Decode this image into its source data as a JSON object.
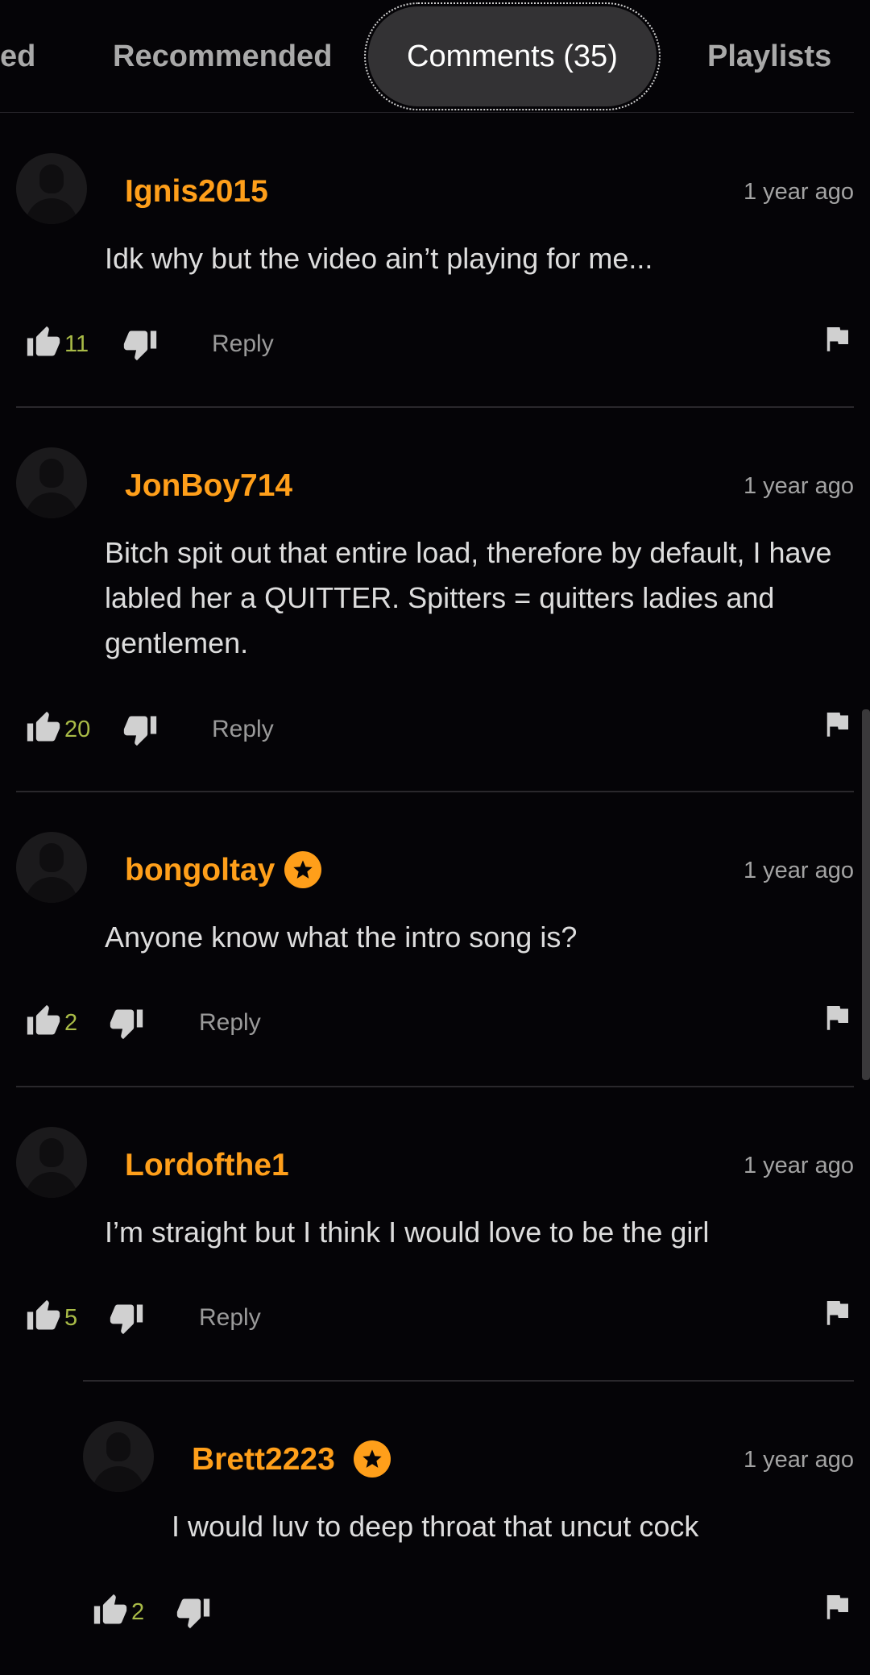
{
  "tabs": [
    {
      "label": "ed"
    },
    {
      "label": "Recommended"
    },
    {
      "label": "Comments (35)",
      "active": true
    },
    {
      "label": "Playlists"
    }
  ],
  "reply_label": "Reply",
  "comments": [
    {
      "user": "Ignis2015",
      "time": "1 year ago",
      "text": "Idk why but the video ain’t playing for me...",
      "likes": "11",
      "badge": false
    },
    {
      "user": "JonBoy714",
      "time": "1 year ago",
      "text": "Bitch spit out that entire load, therefore by default, I have labled her a QUITTER. Spitters = quitters ladies and gentlemen.",
      "likes": "20",
      "badge": false
    },
    {
      "user": "bongoltay",
      "time": "1 year ago",
      "text": "Anyone know what the intro song is?",
      "likes": "2",
      "badge": true
    },
    {
      "user": "Lordofthe1",
      "time": "1 year ago",
      "text": "I’m straight but I think I would love to be the girl",
      "likes": "5",
      "badge": false
    },
    {
      "user": "Brett2223",
      "time": "1 year ago",
      "text": "I would luv to deep throat that uncut cock",
      "likes": "2",
      "badge": true,
      "reply": true
    }
  ],
  "colors": {
    "username": "#ff9f1a",
    "likes": "#a9bb47",
    "background": "#050407"
  },
  "icons": [
    "thumbs-up-icon",
    "thumbs-down-icon",
    "flag-icon",
    "star-badge-icon",
    "avatar-placeholder-icon"
  ]
}
